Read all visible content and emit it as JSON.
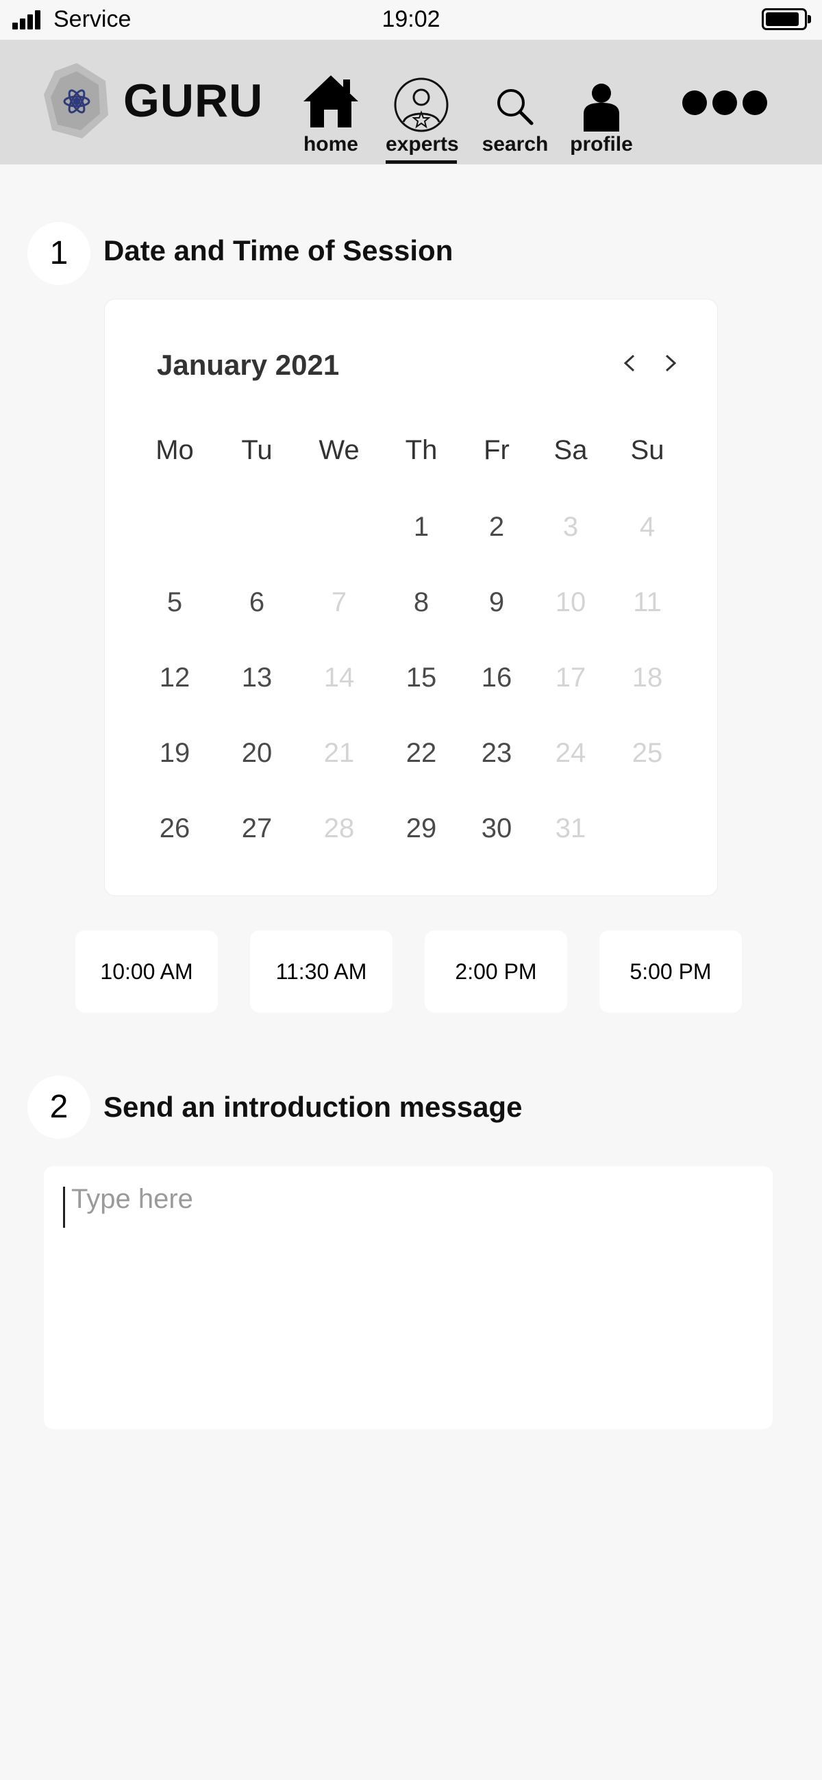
{
  "status_bar": {
    "carrier": "Service",
    "time": "19:02"
  },
  "header": {
    "brand": "GURU",
    "nav": [
      {
        "label": "home",
        "icon": "home-icon",
        "active": false
      },
      {
        "label": "experts",
        "icon": "expert-avatar-icon",
        "active": true
      },
      {
        "label": "search",
        "icon": "search-icon",
        "active": false
      },
      {
        "label": "profile",
        "icon": "profile-icon",
        "active": false
      }
    ],
    "more_icon": "more-dots-icon"
  },
  "step1": {
    "number": "1",
    "title": "Date and Time of Session"
  },
  "calendar": {
    "month": "January 2021",
    "weekdays": [
      "Mo",
      "Tu",
      "We",
      "Th",
      "Fr",
      "Sa",
      "Su"
    ],
    "weeks": [
      [
        "",
        "",
        "",
        "1",
        "2",
        "3",
        "4"
      ],
      [
        "5",
        "6",
        "7",
        "8",
        "9",
        "10",
        "11"
      ],
      [
        "12",
        "13",
        "14",
        "15",
        "16",
        "17",
        "18"
      ],
      [
        "19",
        "20",
        "21",
        "22",
        "23",
        "24",
        "25"
      ],
      [
        "26",
        "27",
        "28",
        "29",
        "30",
        "31",
        ""
      ]
    ],
    "unavailable_days": [
      "3",
      "4",
      "7",
      "10",
      "11",
      "14",
      "17",
      "18",
      "21",
      "24",
      "25",
      "28",
      "31"
    ]
  },
  "time_slots": [
    "10:00 AM",
    "11:30 AM",
    "2:00 PM",
    "5:00 PM"
  ],
  "step2": {
    "number": "2",
    "title": "Send an introduction message"
  },
  "message": {
    "placeholder": "Type here",
    "value": ""
  },
  "colors": {
    "header_bg": "#dcdcdc",
    "page_bg": "#f7f7f7",
    "muted_day": "#d4d4d4",
    "logo_accent": "#2f3a7a"
  }
}
